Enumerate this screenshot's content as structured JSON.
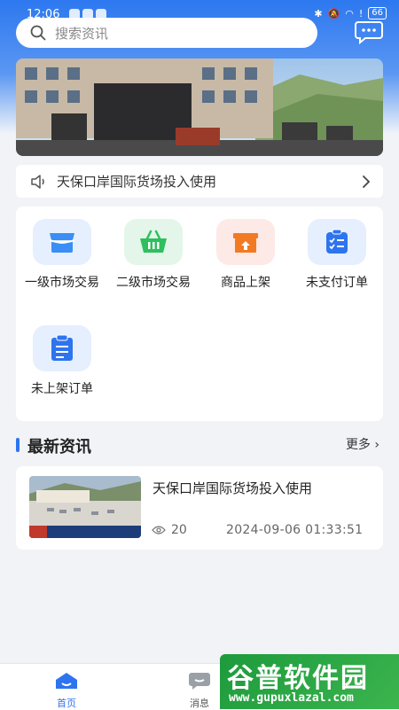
{
  "status_bar": {
    "time": "12:06",
    "battery": "66"
  },
  "search": {
    "placeholder": "搜索资讯"
  },
  "notice": {
    "text": "天保口岸国际货场投入使用"
  },
  "services": [
    {
      "label": "一级市场交易",
      "icon": "market-basket-icon",
      "color": "#3a8ef5"
    },
    {
      "label": "二级市场交易",
      "icon": "shopping-basket-icon",
      "color": "#2fbf5d"
    },
    {
      "label": "商品上架",
      "icon": "box-upload-icon",
      "color": "#f27a23"
    },
    {
      "label": "未支付订单",
      "icon": "checklist-icon",
      "color": "#2e74ef"
    },
    {
      "label": "未上架订单",
      "icon": "clipboard-icon",
      "color": "#2e74ef"
    }
  ],
  "news_section": {
    "title": "最新资讯",
    "more": "更多"
  },
  "news": [
    {
      "title": "天保口岸国际货场投入使用",
      "views": "20",
      "date": "2024-09-06 01:33:51"
    }
  ],
  "tabs": [
    {
      "label": "首页",
      "icon": "home-icon",
      "active": true
    },
    {
      "label": "消息",
      "icon": "message-icon",
      "active": false
    }
  ],
  "watermark": {
    "title": "谷普软件园",
    "url": "www.gupuxlazal.com"
  },
  "colors": {
    "primary": "#2e74ef",
    "background": "#f1f3f7"
  }
}
